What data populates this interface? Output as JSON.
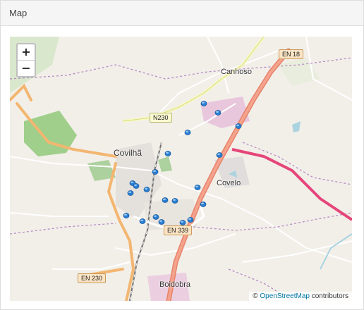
{
  "panel": {
    "title": "Map"
  },
  "map": {
    "zoom_in_label": "+",
    "zoom_out_label": "−",
    "attribution_prefix": "©",
    "attribution_link": "OpenStreetMap",
    "attribution_suffix": "contributors",
    "places": {
      "canhoso": "Canhoso",
      "covilha": "Covilhã",
      "covelo": "Covelo",
      "boidobra": "Boidobra"
    },
    "road_shields": {
      "en18": "EN 18",
      "n230": "N230",
      "en339": "EN 339",
      "en230": "EN 230"
    },
    "marker_color": "#2a7fd4"
  }
}
